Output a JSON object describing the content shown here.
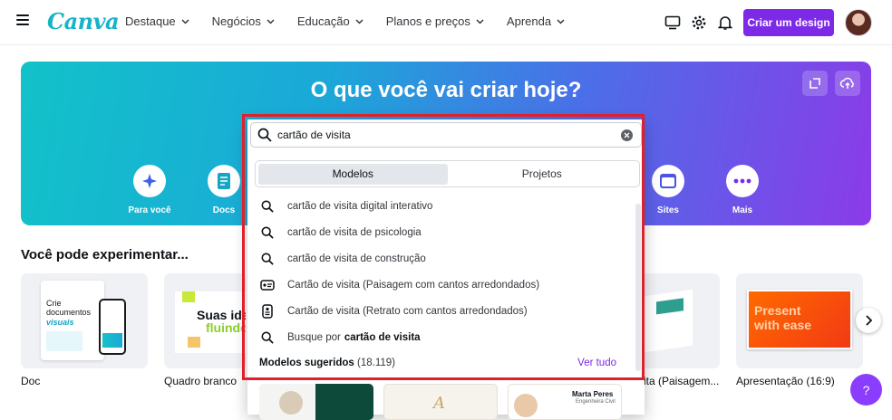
{
  "brand": {
    "logo_text": "Canva",
    "accent": "#7d2ae8",
    "teal": "#16b4c8"
  },
  "nav": {
    "items": [
      {
        "label": "Destaque"
      },
      {
        "label": "Negócios"
      },
      {
        "label": "Educação"
      },
      {
        "label": "Planos e preços"
      },
      {
        "label": "Aprenda"
      }
    ],
    "create_label": "Criar um design",
    "icons": [
      "monitor-icon",
      "gear-icon",
      "bell-icon"
    ]
  },
  "hero": {
    "title": "O que você vai criar hoje?",
    "categories": [
      {
        "label": "Para você",
        "icon": "sparkle-icon"
      },
      {
        "label": "Docs",
        "icon": "doc-icon"
      },
      {
        "label": "Sites",
        "icon": "browser-icon"
      },
      {
        "label": "Mais",
        "icon": "dots-icon"
      }
    ]
  },
  "search": {
    "value": "cartão de visita",
    "tabs": [
      {
        "label": "Modelos",
        "active": true
      },
      {
        "label": "Projetos",
        "active": false
      }
    ],
    "suggestions": [
      {
        "text": "cartão de visita digital interativo",
        "icon": "search-icon"
      },
      {
        "text": "cartão de visita de psicologia",
        "icon": "search-icon"
      },
      {
        "text": "cartão de visita de construção",
        "icon": "search-icon"
      },
      {
        "text": "Cartão de visita (Paisagem com cantos arredondados)",
        "icon": "landscape-card-icon"
      },
      {
        "text": "Cartão de visita (Retrato com cantos arredondados)",
        "icon": "portrait-card-icon"
      }
    ],
    "search_for": {
      "prefix": "Busque por",
      "term": "cartão de visita"
    },
    "models_label": "Modelos sugeridos",
    "models_count": "(18.119)",
    "see_all": "Ver tudo"
  },
  "section": {
    "title": "Você pode experimentar...",
    "cards": [
      {
        "label": "Doc",
        "thumb_text_1": "Crie documentos",
        "thumb_text_2": "visuais"
      },
      {
        "label": "Quadro branco",
        "thumb_text_1": "Suas ideias",
        "thumb_text_2": "fluindo"
      },
      {
        "label": "sita (Paisagem..."
      },
      {
        "label": "Apresentação (16:9)",
        "thumb_text_1": "Present",
        "thumb_text_2": "with ease"
      }
    ]
  },
  "template_thumbs": [
    {
      "name": "Marta Peres",
      "role": "Engenheira Civil"
    }
  ],
  "help_label": "?"
}
